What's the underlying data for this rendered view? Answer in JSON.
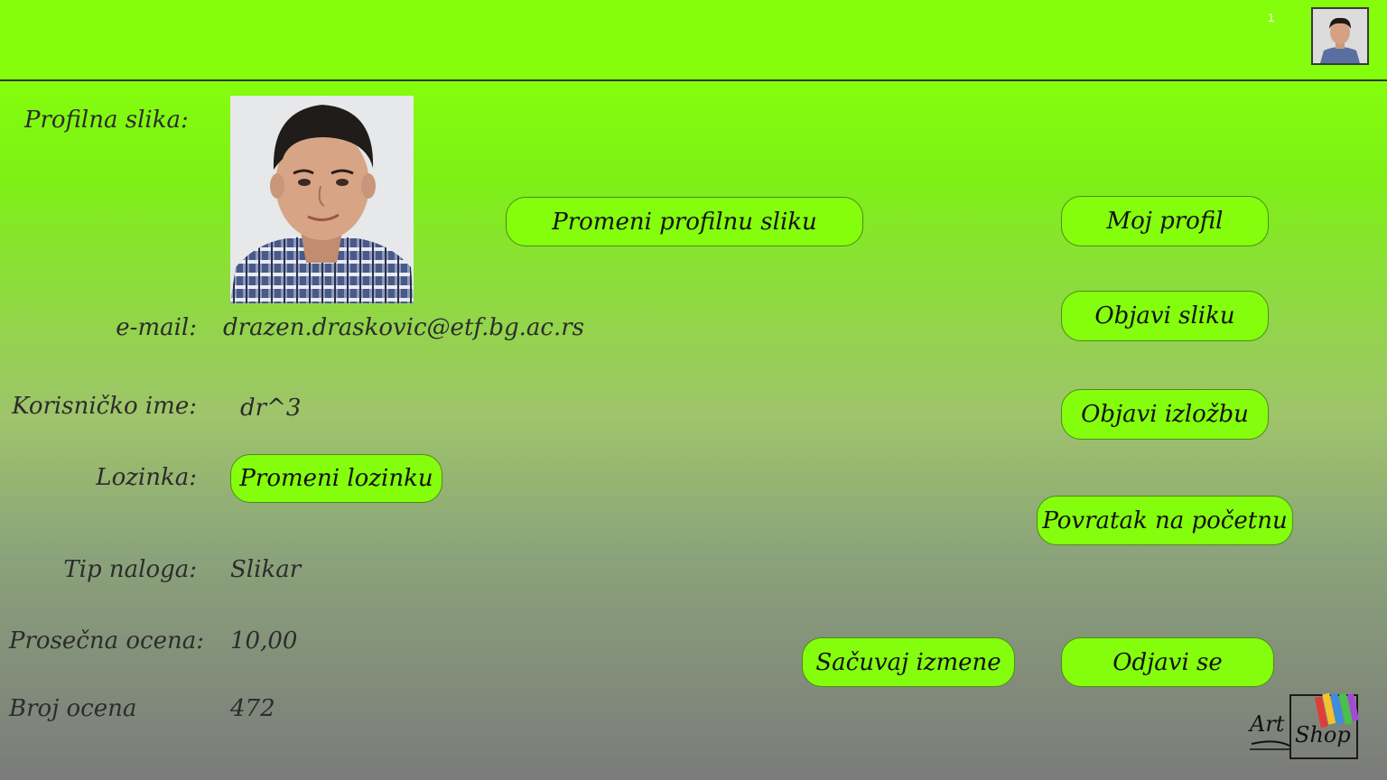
{
  "header": {
    "notification_count": "1"
  },
  "profile": {
    "picture_label": "Profilna slika:",
    "email_label": "e-mail:",
    "email_value": "drazen.draskovic@etf.bg.ac.rs",
    "username_label": "Korisničko ime:",
    "username_value": "dr^3",
    "password_label": "Lozinka:",
    "account_type_label": "Tip naloga:",
    "account_type_value": "Slikar",
    "avg_rating_label": "Prosečna ocena:",
    "avg_rating_value": "10,00",
    "rating_count_label": "Broj ocena",
    "rating_count_value": "472"
  },
  "buttons": {
    "change_picture": "Promeni profilnu sliku",
    "change_password": "Promeni lozinku",
    "my_profile": "Moj profil",
    "publish_picture": "Objavi sliku",
    "publish_exhibition": "Objavi izložbu",
    "back_home": "Povratak na početnu",
    "save_changes": "Sačuvaj izmene",
    "logout": "Odjavi se"
  },
  "logo": {
    "word1": "Art",
    "word2": "Shop"
  },
  "colors": {
    "accent": "#84fe0c",
    "button_border": "#4e8a1c"
  }
}
